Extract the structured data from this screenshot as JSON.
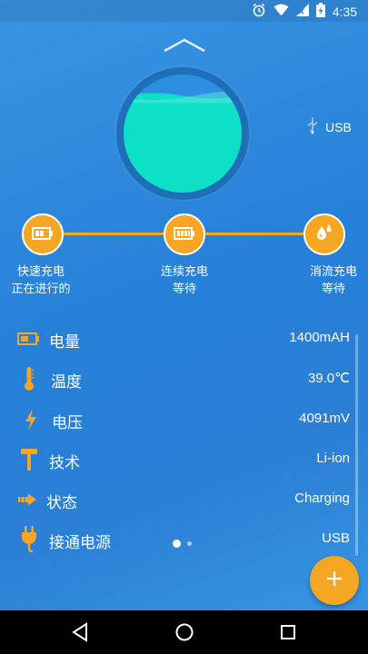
{
  "status_bar": {
    "time": "4:35",
    "icons": [
      "alarm-icon",
      "wifi-icon",
      "signal-icon",
      "battery-charging-icon"
    ]
  },
  "battery": {
    "level": 0.82,
    "source": "USB",
    "fill_color": "#0ee0c8"
  },
  "stages": [
    {
      "line1": "快速充电",
      "line2": "正在进行的",
      "icon": "battery-low-icon"
    },
    {
      "line1": "连续充电",
      "line2": "等待",
      "icon": "battery-full-icon"
    },
    {
      "line1": "消流充电",
      "line2": "等待",
      "icon": "drops-icon"
    }
  ],
  "info": [
    {
      "label": "电量",
      "value": "1400mAH",
      "icon": "battery-icon"
    },
    {
      "label": "温度",
      "value": "39.0℃",
      "icon": "thermometer-icon"
    },
    {
      "label": "电压",
      "value": "4091mV",
      "icon": "lightning-icon"
    },
    {
      "label": "技术",
      "value": "Li-ion",
      "icon": "hammer-icon"
    },
    {
      "label": "状态",
      "value": "Charging",
      "icon": "arrow-icon"
    },
    {
      "label": "接通电源",
      "value": "USB",
      "icon": "plug-icon"
    }
  ],
  "pager": {
    "pages": 2,
    "current": 1
  },
  "fab": {
    "label": "+"
  },
  "colors": {
    "accent": "#f5a623",
    "background": "#2a86dc",
    "ring": "#1f6fb8"
  }
}
